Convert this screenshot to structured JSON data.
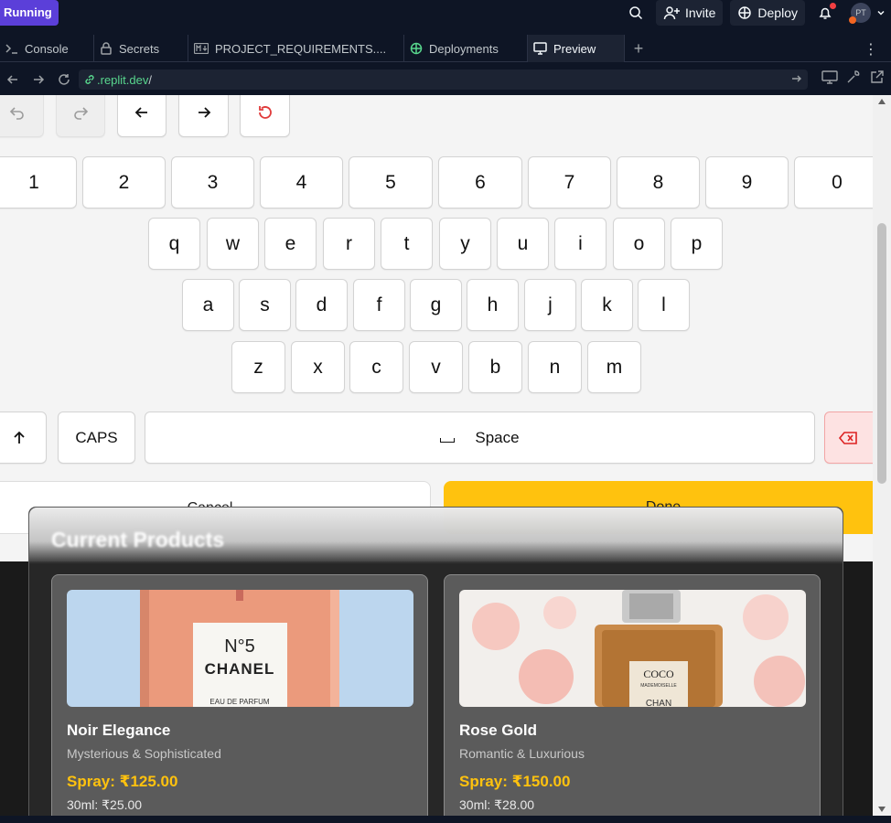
{
  "topbar": {
    "status": "Running",
    "invite_label": "Invite",
    "deploy_label": "Deploy",
    "avatar_initials": "PT"
  },
  "tabs": [
    {
      "label": "Console",
      "icon": "terminal-icon"
    },
    {
      "label": "Secrets",
      "icon": "lock-icon"
    },
    {
      "label": "PROJECT_REQUIREMENTS....",
      "icon": "markdown-icon"
    },
    {
      "label": "Deployments",
      "icon": "deploy-icon"
    },
    {
      "label": "Preview",
      "icon": "monitor-icon",
      "active": true
    }
  ],
  "urlbar": {
    "host": ".replit.dev",
    "path": "/"
  },
  "keyboard": {
    "numbers": [
      "1",
      "2",
      "3",
      "4",
      "5",
      "6",
      "7",
      "8",
      "9",
      "0"
    ],
    "row1": [
      "q",
      "w",
      "e",
      "r",
      "t",
      "y",
      "u",
      "i",
      "o",
      "p"
    ],
    "row2": [
      "a",
      "s",
      "d",
      "f",
      "g",
      "h",
      "j",
      "k",
      "l"
    ],
    "row3": [
      "z",
      "x",
      "c",
      "v",
      "b",
      "n",
      "m"
    ],
    "caps_label": "CAPS",
    "space_label": "Space",
    "cancel_label": "Cancel",
    "done_label": "Done"
  },
  "products": {
    "title": "Current Products",
    "items": [
      {
        "name": "Noir Elegance",
        "subtitle": "Mysterious & Sophisticated",
        "spray": "Spray: ₹125.00",
        "ml": "30ml: ₹25.00",
        "bottle_text": "N°5",
        "bottle_brand": "CHANEL",
        "bottle_sub": "EAU DE PARFUM"
      },
      {
        "name": "Rose Gold",
        "subtitle": "Romantic & Luxurious",
        "spray": "Spray: ₹150.00",
        "ml": "30ml: ₹28.00",
        "bottle_text": "COCO",
        "bottle_brand": "MADEMOISELLE",
        "bottle_sub": "CHAN"
      }
    ]
  },
  "colors": {
    "accent": "#ffc20e",
    "running": "#5b3fd9",
    "backspace": "#fde2e2"
  }
}
